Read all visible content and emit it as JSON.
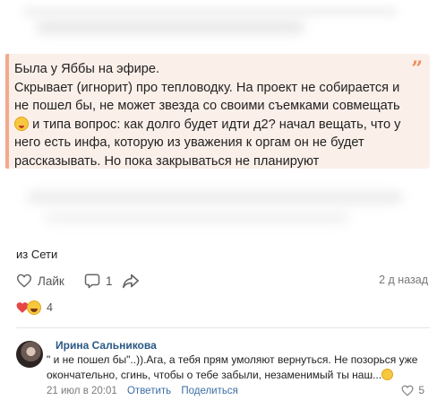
{
  "post": {
    "quote_lines": [
      "Была у Яббы на эфире.",
      "Скрывает (игнорит) про тепловодку. На проект не собирается и",
      "не пошел бы, не может звезда со своими съемками совмещать",
      "и типа вопрос: как долго будет идти д2? начал вещать, что у",
      "него есть инфа, которую из уважения к оргам он не будет",
      "рассказывать. Но пока закрываться не планируют"
    ],
    "source": "из Сети",
    "like_label": "Лайк",
    "comment_count": "1",
    "time_ago": "2 д назад",
    "reaction_count": "4"
  },
  "comment": {
    "author": "Ирина Сальникова",
    "text_line1": "\" и не пошел бы\"..)).Ага, а тебя прям умоляют вернуться. Не позорься уже",
    "text_line2": "окончательно, сгинь, чтобы о тебе забыли, незаменимый ты наш...",
    "date": "21 июл в 20:01",
    "reply_label": "Ответить",
    "share_label": "Поделиться",
    "like_count": "5"
  },
  "colors": {
    "quote_bg": "#fbefe9",
    "quote_accent": "#f3a98c",
    "quote_mark": "#f08a5d",
    "link": "#2a5885",
    "heart": "#e64646"
  },
  "icons": [
    "heart-outline-icon",
    "comment-icon",
    "share-icon",
    "quote-icon",
    "heart-reaction-icon",
    "laugh-reaction-icon"
  ]
}
